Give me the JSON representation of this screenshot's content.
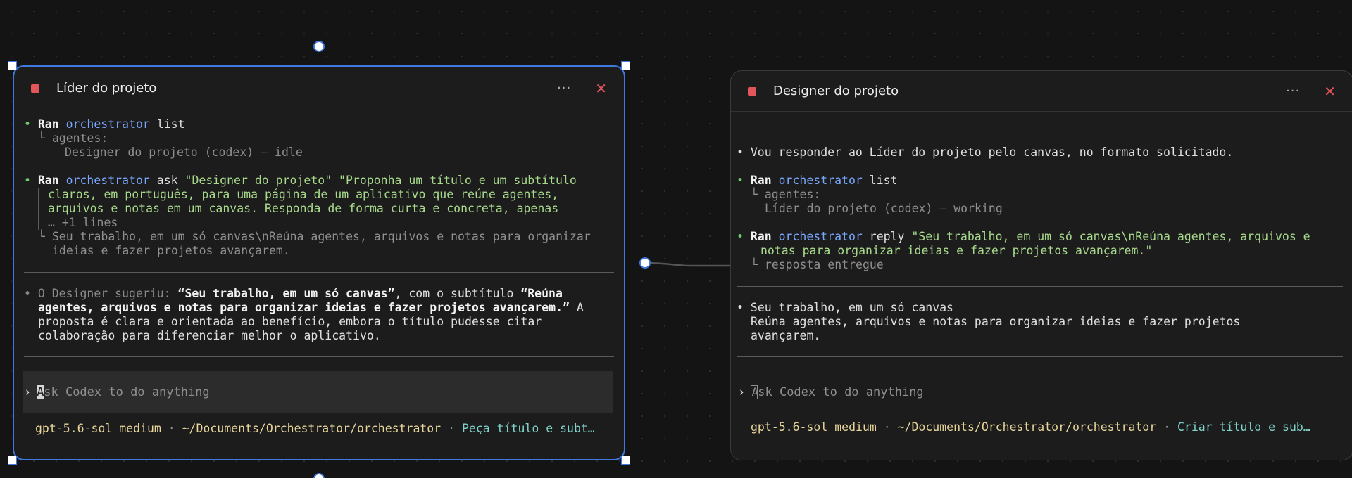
{
  "left": {
    "title": "Líder do projeto",
    "lines": {
      "l1": {
        "b": "• ",
        "ran": "Ran",
        "cmd": "orchestrator",
        "rest": " list"
      },
      "l2": "└ agentes:",
      "l3": "Designer do projeto (codex) — idle",
      "l4": {
        "b": "• ",
        "ran": "Ran",
        "cmd": "orchestrator",
        "rest": " ask ",
        "str": "\"Designer do projeto\" \"Proponha um título e um subtítulo"
      },
      "l5": "claros, em português, para uma página de um aplicativo que reúne agentes,",
      "l6": "arquivos e notas em um canvas. Responda de forma curta e concreta, apenas",
      "l7": "… +1 lines",
      "l8": "└ Seu trabalho, em um só canvas\\nReúna agentes, arquivos e notas para organizar",
      "l9": "ideias e fazer projetos avançarem.",
      "s1": {
        "pre": "• O Designer sugeriu: ",
        "t1": "“Seu trabalho, em um só canvas”",
        "mid": ", com o subtítulo ",
        "t2a": "“Reúna"
      },
      "s2": {
        "t2b": "agentes, arquivos e notas para organizar ideias e fazer projetos avançarem.”",
        "post": " A"
      },
      "s3": "proposta é clara e orientada ao benefício, embora o título pudesse citar",
      "s4": "colaboração para diferenciar melhor o aplicativo."
    },
    "input": {
      "caret": "›",
      "cursor_char": "A",
      "placeholder": "sk Codex to do anything"
    },
    "footer": {
      "model": "gpt-5.6-sol medium",
      "sep": " · ",
      "path": "~/Documents/Orchestrator/orchestrator",
      "task": "Peça título e subt…"
    }
  },
  "right": {
    "title": "Designer do projeto",
    "lines": {
      "r1": "• Vou responder ao Líder do projeto pelo canvas, no formato solicitado.",
      "r2": {
        "b": "• ",
        "ran": "Ran",
        "cmd": "orchestrator",
        "rest": " list"
      },
      "r3": "└ agentes:",
      "r4": "Líder do projeto (codex) — working",
      "r5": {
        "b": "• ",
        "ran": "Ran",
        "cmd": "orchestrator",
        "rest": " reply ",
        "str": "\"Seu trabalho, em um só canvas\\nReúna agentes, arquivos e"
      },
      "r6": "notas para organizar ideias e fazer projetos avançarem.\"",
      "r7": "└ resposta entregue",
      "r8": "• Seu trabalho, em um só canvas",
      "r9": "Reúna agentes, arquivos e notas para organizar ideias e fazer projetos",
      "r10": "avançarem."
    },
    "input": {
      "caret": "›",
      "cursor_char": "A",
      "placeholder": "sk Codex to do anything"
    },
    "footer": {
      "model": "gpt-5.6-sol medium",
      "sep": " · ",
      "path": "~/Documents/Orchestrator/orchestrator",
      "task": "Criar título e sub…"
    }
  },
  "colors": {
    "selection": "#3e78e0",
    "stop": "#e2555a",
    "bullet_active": "#6bd06b",
    "command": "#7aa7ff",
    "string": "#a9da8c"
  }
}
